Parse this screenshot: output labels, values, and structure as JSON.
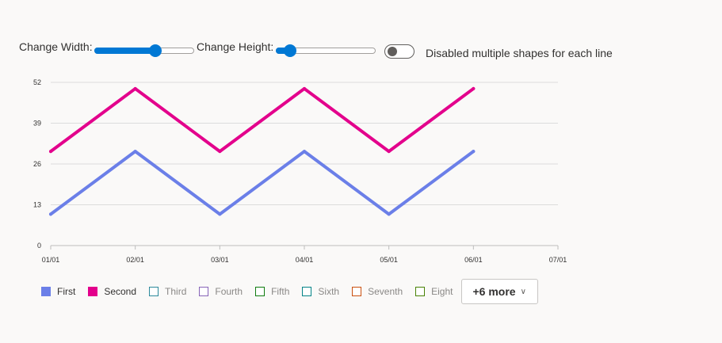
{
  "controls": {
    "width_label": "Change Width:",
    "height_label": "Change Height:",
    "width_value": 0.61,
    "height_value": 0.14,
    "toggle_label": "Disabled multiple shapes for each line",
    "toggle_on": false
  },
  "chart_data": {
    "type": "line",
    "x": [
      "01/01",
      "02/01",
      "03/01",
      "04/01",
      "05/01",
      "06/01"
    ],
    "x_ticks": [
      "01/01",
      "02/01",
      "03/01",
      "04/01",
      "05/01",
      "06/01",
      "07/01"
    ],
    "y_ticks": [
      0,
      13,
      26,
      39,
      52
    ],
    "ylim": [
      0,
      52
    ],
    "grid": true,
    "legend_position": "bottom-left",
    "series": [
      {
        "name": "First",
        "color": "#6b7fe8",
        "values": [
          10,
          30,
          10,
          30,
          10,
          30
        ]
      },
      {
        "name": "Second",
        "color": "#e3008c",
        "values": [
          30,
          50,
          30,
          50,
          30,
          50
        ]
      }
    ]
  },
  "legend": {
    "items": [
      {
        "name": "First",
        "color": "#6b7fe8",
        "active": true
      },
      {
        "name": "Second",
        "color": "#e3008c",
        "active": true
      },
      {
        "name": "Third",
        "color": "#2d8a9c",
        "active": false
      },
      {
        "name": "Fourth",
        "color": "#8764b8",
        "active": false
      },
      {
        "name": "Fifth",
        "color": "#107c10",
        "active": false
      },
      {
        "name": "Sixth",
        "color": "#038387",
        "active": false
      },
      {
        "name": "Seventh",
        "color": "#ca5010",
        "active": false
      },
      {
        "name": "Eight",
        "color": "#498205",
        "active": false
      }
    ],
    "more_label": "+6 more"
  }
}
